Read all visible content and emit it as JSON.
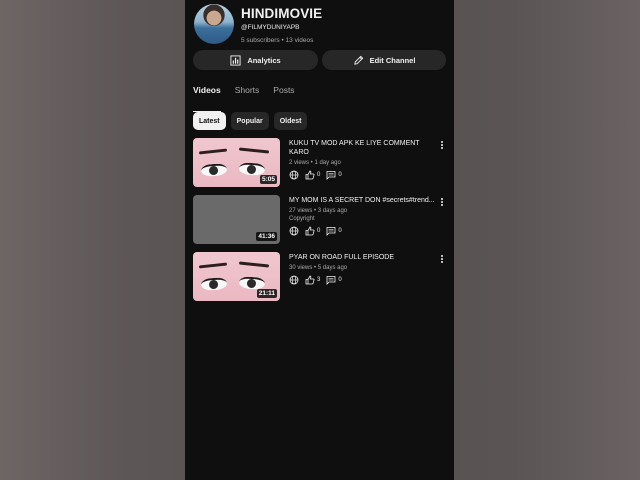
{
  "channel": {
    "name": "HINDIMOVIE",
    "handle": "@FILMYDUNIYAPB",
    "stats": "5 subscribers • 13 videos"
  },
  "buttons": {
    "analytics": "Analytics",
    "edit_channel": "Edit Channel"
  },
  "tabs": [
    {
      "label": "Videos",
      "active": true
    },
    {
      "label": "Shorts",
      "active": false
    },
    {
      "label": "Posts",
      "active": false
    }
  ],
  "chips": [
    {
      "label": "Latest",
      "selected": true
    },
    {
      "label": "Popular",
      "selected": false
    },
    {
      "label": "Oldest",
      "selected": false
    }
  ],
  "videos": [
    {
      "title": "KUKU TV MOD APK KE LIYE COMMENT KARO",
      "sub": "2 views • 1 day ago",
      "extra": "",
      "duration": "5:05",
      "likes": "0",
      "comments": "0",
      "thumb": "eyes"
    },
    {
      "title": "MY MOM IS A SECRET DON #secrets#trend...",
      "sub": "27 views • 3 days ago",
      "extra": "Copyright",
      "duration": "41:36",
      "likes": "0",
      "comments": "0",
      "thumb": "blank"
    },
    {
      "title": "PYAR ON ROAD FULL EPISODE",
      "sub": "30 views • 5 days ago",
      "extra": "",
      "duration": "21:11",
      "likes": "3",
      "comments": "0",
      "thumb": "eyes"
    }
  ],
  "icons": {
    "analytics": "bar-chart-icon",
    "edit": "pencil-icon",
    "visibility": "globe-icon",
    "like": "thumbs-up-icon",
    "comment": "comment-icon",
    "menu": "more-vertical-icon"
  }
}
